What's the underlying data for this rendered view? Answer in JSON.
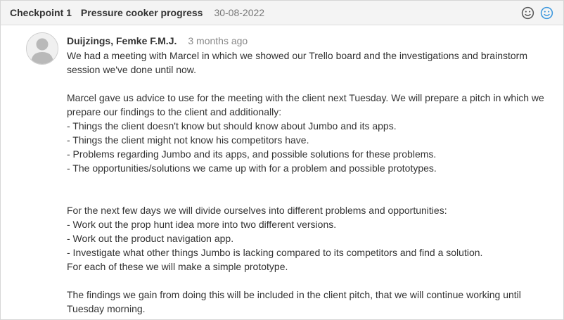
{
  "header": {
    "checkpoint": "Checkpoint 1",
    "title": "Pressure cooker progress",
    "date": "30-08-2022",
    "icons": [
      "neutral-face-icon",
      "smiley-face-icon"
    ],
    "colors": {
      "neutral": "#555555",
      "happy": "#3a96dd"
    }
  },
  "comment": {
    "author": "Duijzings, Femke F.M.J.",
    "time": "3 months ago",
    "para1": "We had a meeting with Marcel in which we showed our Trello board and the investigations and brainstorm session we've done until now.",
    "para2_intro": "Marcel gave us advice to use for the meeting with the client next Tuesday. We will prepare a pitch in which we prepare our findings to the client and additionally:",
    "list1": [
      "- Things the client doesn't know but should know about Jumbo and its apps.",
      "- Things the client might not know his competitors have.",
      "- Problems regarding Jumbo and its apps, and possible solutions for these problems.",
      "- The opportunities/solutions we came up with for a problem and possible prototypes."
    ],
    "para3_intro": "For the next few days we will divide ourselves into different problems and opportunities:",
    "list2": [
      "- Work out the prop hunt idea more into two different versions.",
      "- Work out the product navigation app.",
      "- Investigate what other things Jumbo is lacking compared to its competitors and find a solution."
    ],
    "para3_outro": "For each of these we will make a simple prototype.",
    "para4": "The findings we gain from doing this will be included in the client pitch, that we will continue working until Tuesday morning."
  }
}
